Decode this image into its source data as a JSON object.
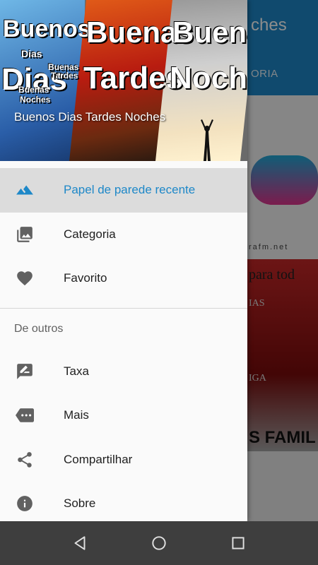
{
  "background_app": {
    "title_fragment": "ches",
    "tab_fragment": "ORIA",
    "url_fragment": "rafm.net",
    "card_text_1": "para tod",
    "card_text_2": "IAS",
    "card_text_3": "IGA",
    "card_text_4": "S FAMIL"
  },
  "drawer": {
    "header": {
      "caption": "Buenos Dias Tardes Noches",
      "art_words": {
        "w1": "Buenos",
        "w1b": "Dias",
        "w1c": "Dias",
        "w1d": "Buenas",
        "w1e": "Tardes",
        "w1f": "Buenas",
        "w1g": "Noches",
        "w2": "Buenas",
        "w2b": "Tardes",
        "w3": "Buenas",
        "w3b": "Noches"
      }
    },
    "items": [
      {
        "label": "Papel de parede recente",
        "icon": "landscape-icon",
        "active": true
      },
      {
        "label": "Categoria",
        "icon": "photo-library-icon",
        "active": false
      },
      {
        "label": "Favorito",
        "icon": "heart-icon",
        "active": false
      }
    ],
    "section_title": "De outros",
    "other_items": [
      {
        "label": "Taxa",
        "icon": "rate-review-icon"
      },
      {
        "label": "Mais",
        "icon": "more-tag-icon"
      },
      {
        "label": "Compartilhar",
        "icon": "share-icon"
      },
      {
        "label": "Sobre",
        "icon": "info-icon"
      }
    ]
  },
  "colors": {
    "accent": "#1e88c8",
    "active_bg": "#dcdcdc",
    "icon": "#616161"
  }
}
